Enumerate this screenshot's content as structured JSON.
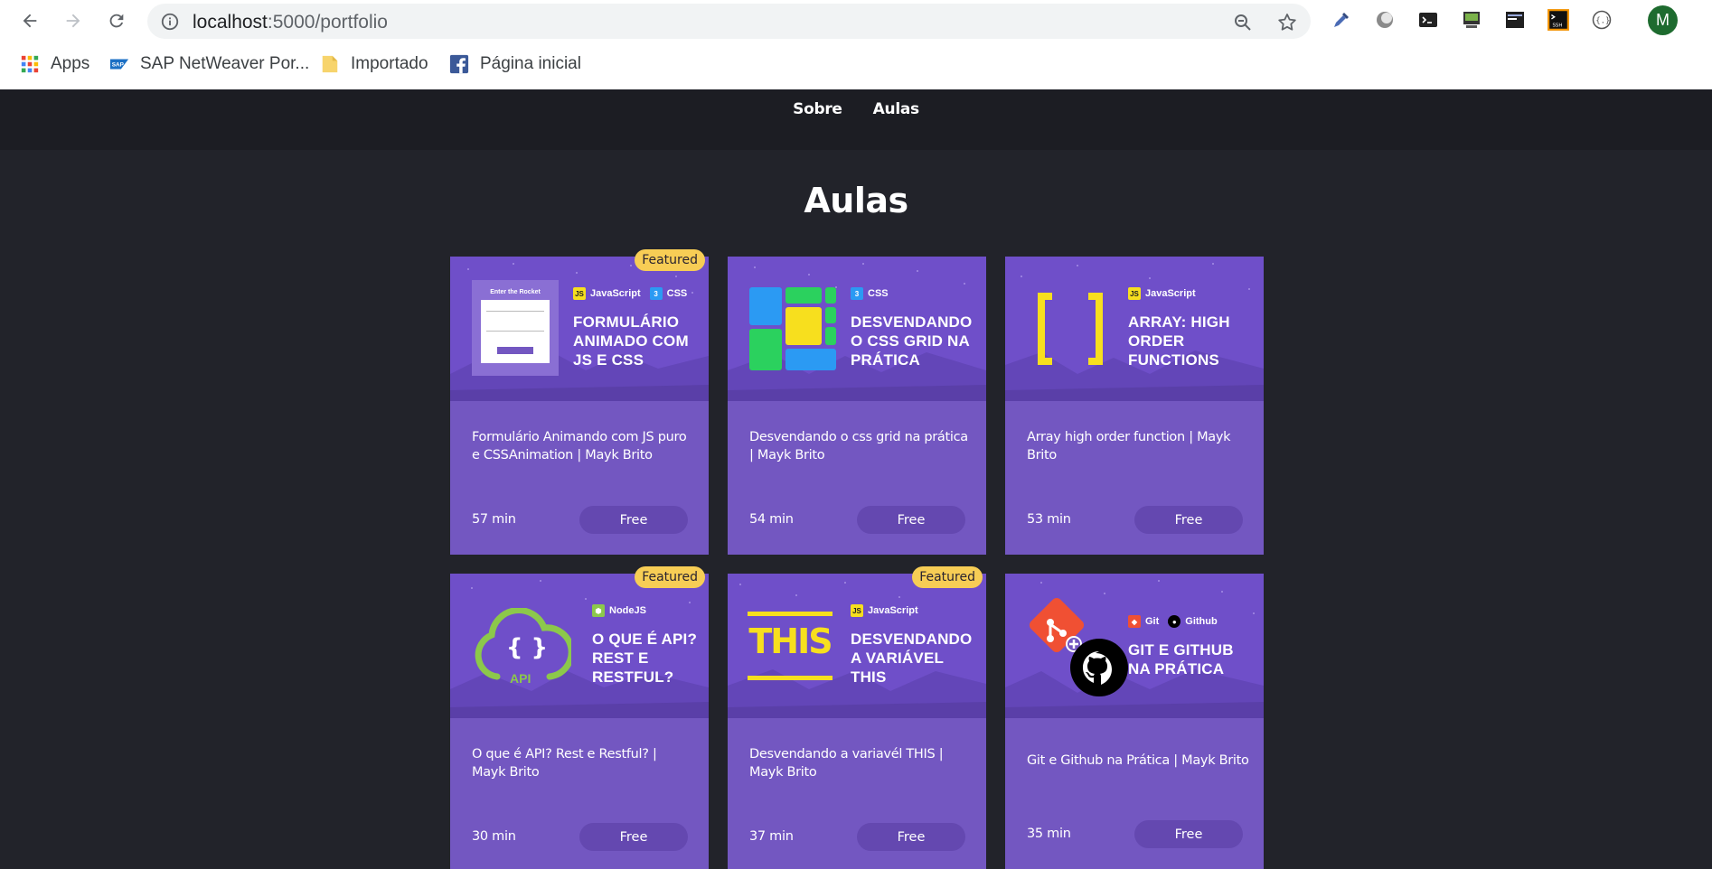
{
  "browser": {
    "url_host": "localhost",
    "url_path": ":5000/portfolio",
    "profile_initial": "M",
    "bookmarks": [
      {
        "label": "Apps",
        "icon": "apps-grid-icon"
      },
      {
        "label": "SAP NetWeaver Por...",
        "icon": "sap-icon"
      },
      {
        "label": "Importado",
        "icon": "folder-icon"
      },
      {
        "label": "Página inicial",
        "icon": "facebook-icon"
      }
    ]
  },
  "site": {
    "nav": [
      "Sobre",
      "Aulas"
    ],
    "title": "Aulas",
    "featured_label": "Featured"
  },
  "courses": [
    {
      "tags": [
        "JavaScript",
        "CSS"
      ],
      "thumb_title": "FORMULÁRIO ANIMADO COM JS E CSS",
      "art_label": "Enter the Rocket",
      "title": "Formulário Animando com JS puro e CSSAnimation | Mayk Brito",
      "duration": "57 min",
      "price": "Free",
      "featured": true
    },
    {
      "tags": [
        "CSS"
      ],
      "thumb_title": "DESVENDANDO O CSS GRID NA PRÁTICA",
      "title": "Desvendando o css grid na prática | Mayk Brito",
      "duration": "54 min",
      "price": "Free",
      "featured": false
    },
    {
      "tags": [
        "JavaScript"
      ],
      "thumb_title": "ARRAY: HIGH ORDER FUNCTIONS",
      "title": "Array high order function | Mayk Brito",
      "duration": "53 min",
      "price": "Free",
      "featured": false
    },
    {
      "tags": [
        "NodeJS"
      ],
      "thumb_title": "O QUE É API? REST E RESTFUL?",
      "art_label": "API",
      "title": "O que é API? Rest e Restful? | Mayk Brito",
      "duration": "30 min",
      "price": "Free",
      "featured": true
    },
    {
      "tags": [
        "JavaScript"
      ],
      "thumb_title": "DESVENDANDO A VARIÁVEL THIS",
      "art_label": "THIS",
      "title": "Desvendando a variavél THIS | Mayk Brito",
      "duration": "37 min",
      "price": "Free",
      "featured": true
    },
    {
      "tags": [
        "Git",
        "Github"
      ],
      "thumb_title": "GIT E GITHUB NA PRÁTICA",
      "title": "Git e Github na Prática | Mayk Brito",
      "duration": "35 min",
      "price": "Free",
      "featured": false
    }
  ],
  "colors": {
    "page_bg": "#22232a",
    "header_bg": "#1c1d23",
    "card_bg": "#7357c1",
    "thumb_bg": "#6f4fc9",
    "price_pill": "#6448b0",
    "featured_badge": "#f7cd55",
    "js_yellow": "#f7df1e",
    "css_blue": "#2b9af3",
    "node_green": "#8cc84b",
    "git_red": "#f05033"
  }
}
